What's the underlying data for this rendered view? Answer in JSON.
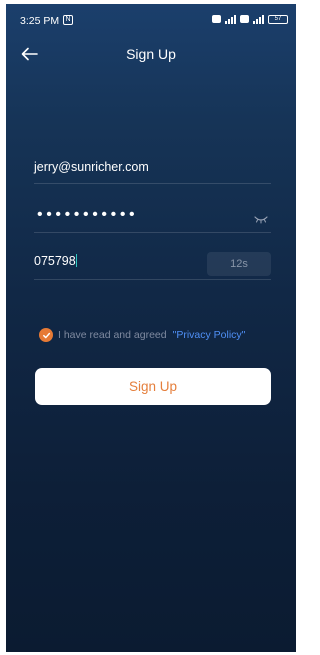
{
  "status_bar": {
    "time": "3:25 PM",
    "battery": "57",
    "network": "4G"
  },
  "header": {
    "title": "Sign Up",
    "back_icon": "arrow-left-icon"
  },
  "form": {
    "email_value": "jerry@sunricher.com",
    "password_mask": "•••••••••••",
    "code_value": "075798",
    "countdown_label": "12s"
  },
  "agreement": {
    "checked": true,
    "text": "I have read and agreed",
    "policy_link": "\"Privacy Policy\""
  },
  "actions": {
    "signup_label": "Sign Up"
  },
  "colors": {
    "background_top": "#1b3f6c",
    "background_bottom": "#0b1b31",
    "accent": "#e57f3c",
    "link": "#4f8ff5"
  }
}
